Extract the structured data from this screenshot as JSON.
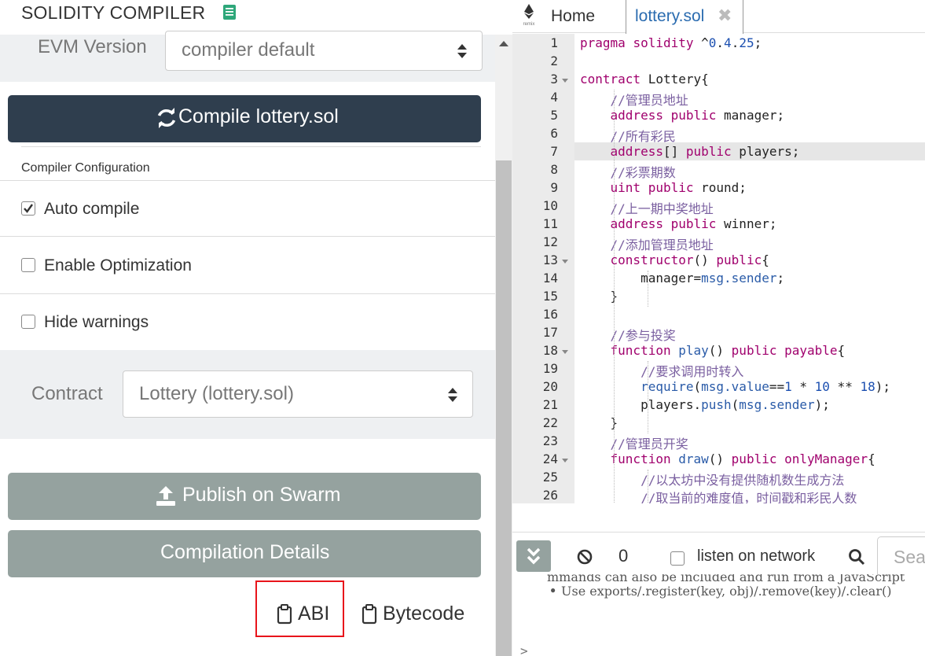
{
  "compiler": {
    "title": "SOLIDITY COMPILER",
    "evm_label": "EVM Version",
    "evm_value": "compiler default",
    "compile_button": "Compile lottery.sol",
    "config_title": "Compiler Configuration",
    "options": [
      {
        "label": "Auto compile",
        "checked": true
      },
      {
        "label": "Enable Optimization",
        "checked": false
      },
      {
        "label": "Hide warnings",
        "checked": false
      }
    ],
    "contract_label": "Contract",
    "contract_value": "Lottery (lottery.sol)",
    "publish_button": "Publish on Swarm",
    "details_button": "Compilation Details",
    "abi_button": "ABI",
    "bytecode_button": "Bytecode"
  },
  "tabs": {
    "home_logo": "remix",
    "home_label": "Home",
    "file_label": "lottery.sol",
    "close_icon": "✖"
  },
  "editor": {
    "active_line": 7,
    "line_numbers": [
      "1",
      "2",
      "3",
      "4",
      "5",
      "6",
      "7",
      "8",
      "9",
      "10",
      "11",
      "12",
      "13",
      "14",
      "15",
      "16",
      "17",
      "18",
      "19",
      "20",
      "21",
      "22",
      "23",
      "24",
      "25",
      "26"
    ],
    "lines": [
      "pragma solidity ^0.4.25;",
      "",
      "contract Lottery{",
      "    //管理员地址",
      "    address public manager;",
      "    //所有彩民",
      "    address[] public players;",
      "    //彩票期数",
      "    uint public round;",
      "    //上一期中奖地址",
      "    address public winner;",
      "    //添加管理员地址",
      "    constructor() public{",
      "        manager=msg.sender;",
      "    }",
      "",
      "    //参与投奖",
      "    function play() public payable{",
      "        //要求调用时转入",
      "        require(msg.value==1 * 10 ** 18);",
      "        players.push(msg.sender);",
      "    }",
      "    //管理员开奖",
      "    function draw() public onlyManager{",
      "        //以太坊中没有提供随机数生成方法",
      "        //取当前的难度值，时间戳和彩民人数"
    ]
  },
  "terminal": {
    "count": "0",
    "listen_label": "listen on network",
    "search_placeholder": "Search",
    "line_1": "mmands can also be included and run from a JavaScript",
    "line_2": "Use exports/.register(key, obj)/.remove(key)/.clear()",
    "prompt": ">"
  }
}
